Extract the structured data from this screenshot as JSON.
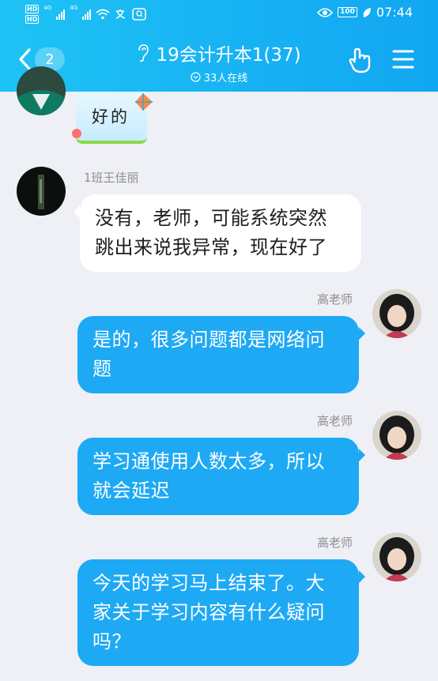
{
  "status_bar": {
    "hd_label": "HD",
    "signal_label": "4G",
    "time": "07:44",
    "battery": "100"
  },
  "header": {
    "unread_count": "2",
    "title": "19会计升本1(37)",
    "online_count": "33人在线"
  },
  "colors": {
    "header_start": "#1ec3f5",
    "header_end": "#11a6f2",
    "outgoing_bubble": "#1ea9f4",
    "incoming_bubble": "#ffffff",
    "background": "#eef0f5"
  },
  "messages": [
    {
      "type": "sticker",
      "direction": "in",
      "text": "好的"
    },
    {
      "type": "text",
      "direction": "in",
      "sender": "1班王佳丽",
      "lines": [
        "没有，老师，可能系统突然",
        "跳出来说我异常，现在好了"
      ]
    },
    {
      "type": "text",
      "direction": "out",
      "sender": "高老师",
      "lines": [
        "是的，很多问题都是网络问",
        "题"
      ]
    },
    {
      "type": "text",
      "direction": "out",
      "sender": "高老师",
      "lines": [
        "学习通使用人数太多，所以",
        "就会延迟"
      ]
    },
    {
      "type": "text",
      "direction": "out",
      "sender": "高老师",
      "lines": [
        "今天的学习马上结束了。大",
        "家关于学习内容有什么疑问",
        "吗？"
      ]
    }
  ]
}
